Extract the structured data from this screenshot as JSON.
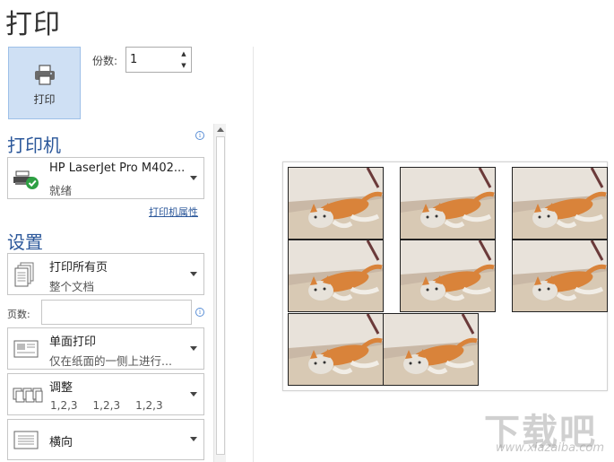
{
  "title": "打印",
  "print_button": {
    "label": "打印",
    "icon": "printer-icon"
  },
  "copies": {
    "label": "份数:",
    "value": "1"
  },
  "printer": {
    "heading": "打印机",
    "name": "HP LaserJet Pro M402...",
    "status": "就绪",
    "properties_link": "打印机属性",
    "status_color": "#2ea043"
  },
  "settings": {
    "heading": "设置",
    "range": {
      "main": "打印所有页",
      "sub": "整个文档"
    },
    "pages": {
      "label": "页数:",
      "value": ""
    },
    "sides": {
      "main": "单面打印",
      "sub": "仅在纸面的一侧上进行..."
    },
    "collate": {
      "main": "调整",
      "groups": [
        "1,2,3",
        "1,2,3",
        "1,2,3"
      ]
    },
    "orientation": {
      "main": "横向"
    }
  },
  "preview": {
    "photo_count": 8
  },
  "watermark": {
    "brand": "下载吧",
    "url": "www.xiazaiba.com"
  },
  "colors": {
    "accent": "#2b579a",
    "button_bg": "#cfe0f4"
  }
}
